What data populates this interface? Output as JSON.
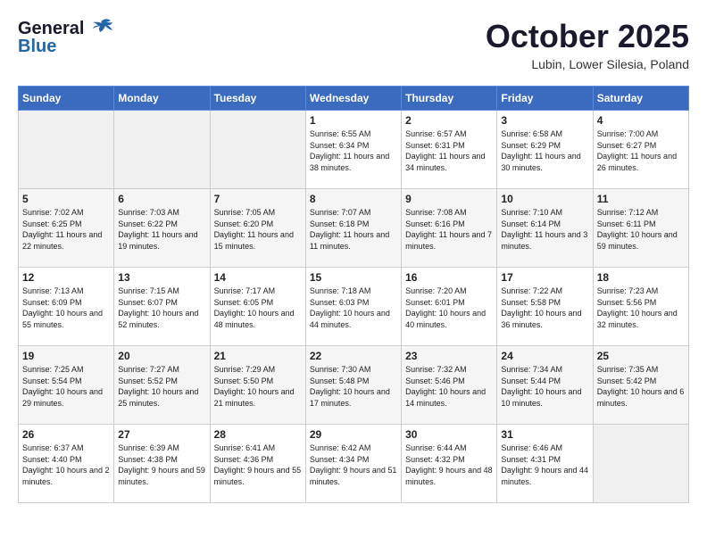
{
  "header": {
    "logo_line1": "General",
    "logo_line2": "Blue",
    "month": "October 2025",
    "location": "Lubin, Lower Silesia, Poland"
  },
  "days_of_week": [
    "Sunday",
    "Monday",
    "Tuesday",
    "Wednesday",
    "Thursday",
    "Friday",
    "Saturday"
  ],
  "weeks": [
    [
      {
        "day": null
      },
      {
        "day": null
      },
      {
        "day": null
      },
      {
        "day": "1",
        "sunrise": "6:55 AM",
        "sunset": "6:34 PM",
        "daylight": "11 hours and 38 minutes."
      },
      {
        "day": "2",
        "sunrise": "6:57 AM",
        "sunset": "6:31 PM",
        "daylight": "11 hours and 34 minutes."
      },
      {
        "day": "3",
        "sunrise": "6:58 AM",
        "sunset": "6:29 PM",
        "daylight": "11 hours and 30 minutes."
      },
      {
        "day": "4",
        "sunrise": "7:00 AM",
        "sunset": "6:27 PM",
        "daylight": "11 hours and 26 minutes."
      }
    ],
    [
      {
        "day": "5",
        "sunrise": "7:02 AM",
        "sunset": "6:25 PM",
        "daylight": "11 hours and 22 minutes."
      },
      {
        "day": "6",
        "sunrise": "7:03 AM",
        "sunset": "6:22 PM",
        "daylight": "11 hours and 19 minutes."
      },
      {
        "day": "7",
        "sunrise": "7:05 AM",
        "sunset": "6:20 PM",
        "daylight": "11 hours and 15 minutes."
      },
      {
        "day": "8",
        "sunrise": "7:07 AM",
        "sunset": "6:18 PM",
        "daylight": "11 hours and 11 minutes."
      },
      {
        "day": "9",
        "sunrise": "7:08 AM",
        "sunset": "6:16 PM",
        "daylight": "11 hours and 7 minutes."
      },
      {
        "day": "10",
        "sunrise": "7:10 AM",
        "sunset": "6:14 PM",
        "daylight": "11 hours and 3 minutes."
      },
      {
        "day": "11",
        "sunrise": "7:12 AM",
        "sunset": "6:11 PM",
        "daylight": "10 hours and 59 minutes."
      }
    ],
    [
      {
        "day": "12",
        "sunrise": "7:13 AM",
        "sunset": "6:09 PM",
        "daylight": "10 hours and 55 minutes."
      },
      {
        "day": "13",
        "sunrise": "7:15 AM",
        "sunset": "6:07 PM",
        "daylight": "10 hours and 52 minutes."
      },
      {
        "day": "14",
        "sunrise": "7:17 AM",
        "sunset": "6:05 PM",
        "daylight": "10 hours and 48 minutes."
      },
      {
        "day": "15",
        "sunrise": "7:18 AM",
        "sunset": "6:03 PM",
        "daylight": "10 hours and 44 minutes."
      },
      {
        "day": "16",
        "sunrise": "7:20 AM",
        "sunset": "6:01 PM",
        "daylight": "10 hours and 40 minutes."
      },
      {
        "day": "17",
        "sunrise": "7:22 AM",
        "sunset": "5:58 PM",
        "daylight": "10 hours and 36 minutes."
      },
      {
        "day": "18",
        "sunrise": "7:23 AM",
        "sunset": "5:56 PM",
        "daylight": "10 hours and 32 minutes."
      }
    ],
    [
      {
        "day": "19",
        "sunrise": "7:25 AM",
        "sunset": "5:54 PM",
        "daylight": "10 hours and 29 minutes."
      },
      {
        "day": "20",
        "sunrise": "7:27 AM",
        "sunset": "5:52 PM",
        "daylight": "10 hours and 25 minutes."
      },
      {
        "day": "21",
        "sunrise": "7:29 AM",
        "sunset": "5:50 PM",
        "daylight": "10 hours and 21 minutes."
      },
      {
        "day": "22",
        "sunrise": "7:30 AM",
        "sunset": "5:48 PM",
        "daylight": "10 hours and 17 minutes."
      },
      {
        "day": "23",
        "sunrise": "7:32 AM",
        "sunset": "5:46 PM",
        "daylight": "10 hours and 14 minutes."
      },
      {
        "day": "24",
        "sunrise": "7:34 AM",
        "sunset": "5:44 PM",
        "daylight": "10 hours and 10 minutes."
      },
      {
        "day": "25",
        "sunrise": "7:35 AM",
        "sunset": "5:42 PM",
        "daylight": "10 hours and 6 minutes."
      }
    ],
    [
      {
        "day": "26",
        "sunrise": "6:37 AM",
        "sunset": "4:40 PM",
        "daylight": "10 hours and 2 minutes."
      },
      {
        "day": "27",
        "sunrise": "6:39 AM",
        "sunset": "4:38 PM",
        "daylight": "9 hours and 59 minutes."
      },
      {
        "day": "28",
        "sunrise": "6:41 AM",
        "sunset": "4:36 PM",
        "daylight": "9 hours and 55 minutes."
      },
      {
        "day": "29",
        "sunrise": "6:42 AM",
        "sunset": "4:34 PM",
        "daylight": "9 hours and 51 minutes."
      },
      {
        "day": "30",
        "sunrise": "6:44 AM",
        "sunset": "4:32 PM",
        "daylight": "9 hours and 48 minutes."
      },
      {
        "day": "31",
        "sunrise": "6:46 AM",
        "sunset": "4:31 PM",
        "daylight": "9 hours and 44 minutes."
      },
      {
        "day": null
      }
    ]
  ]
}
